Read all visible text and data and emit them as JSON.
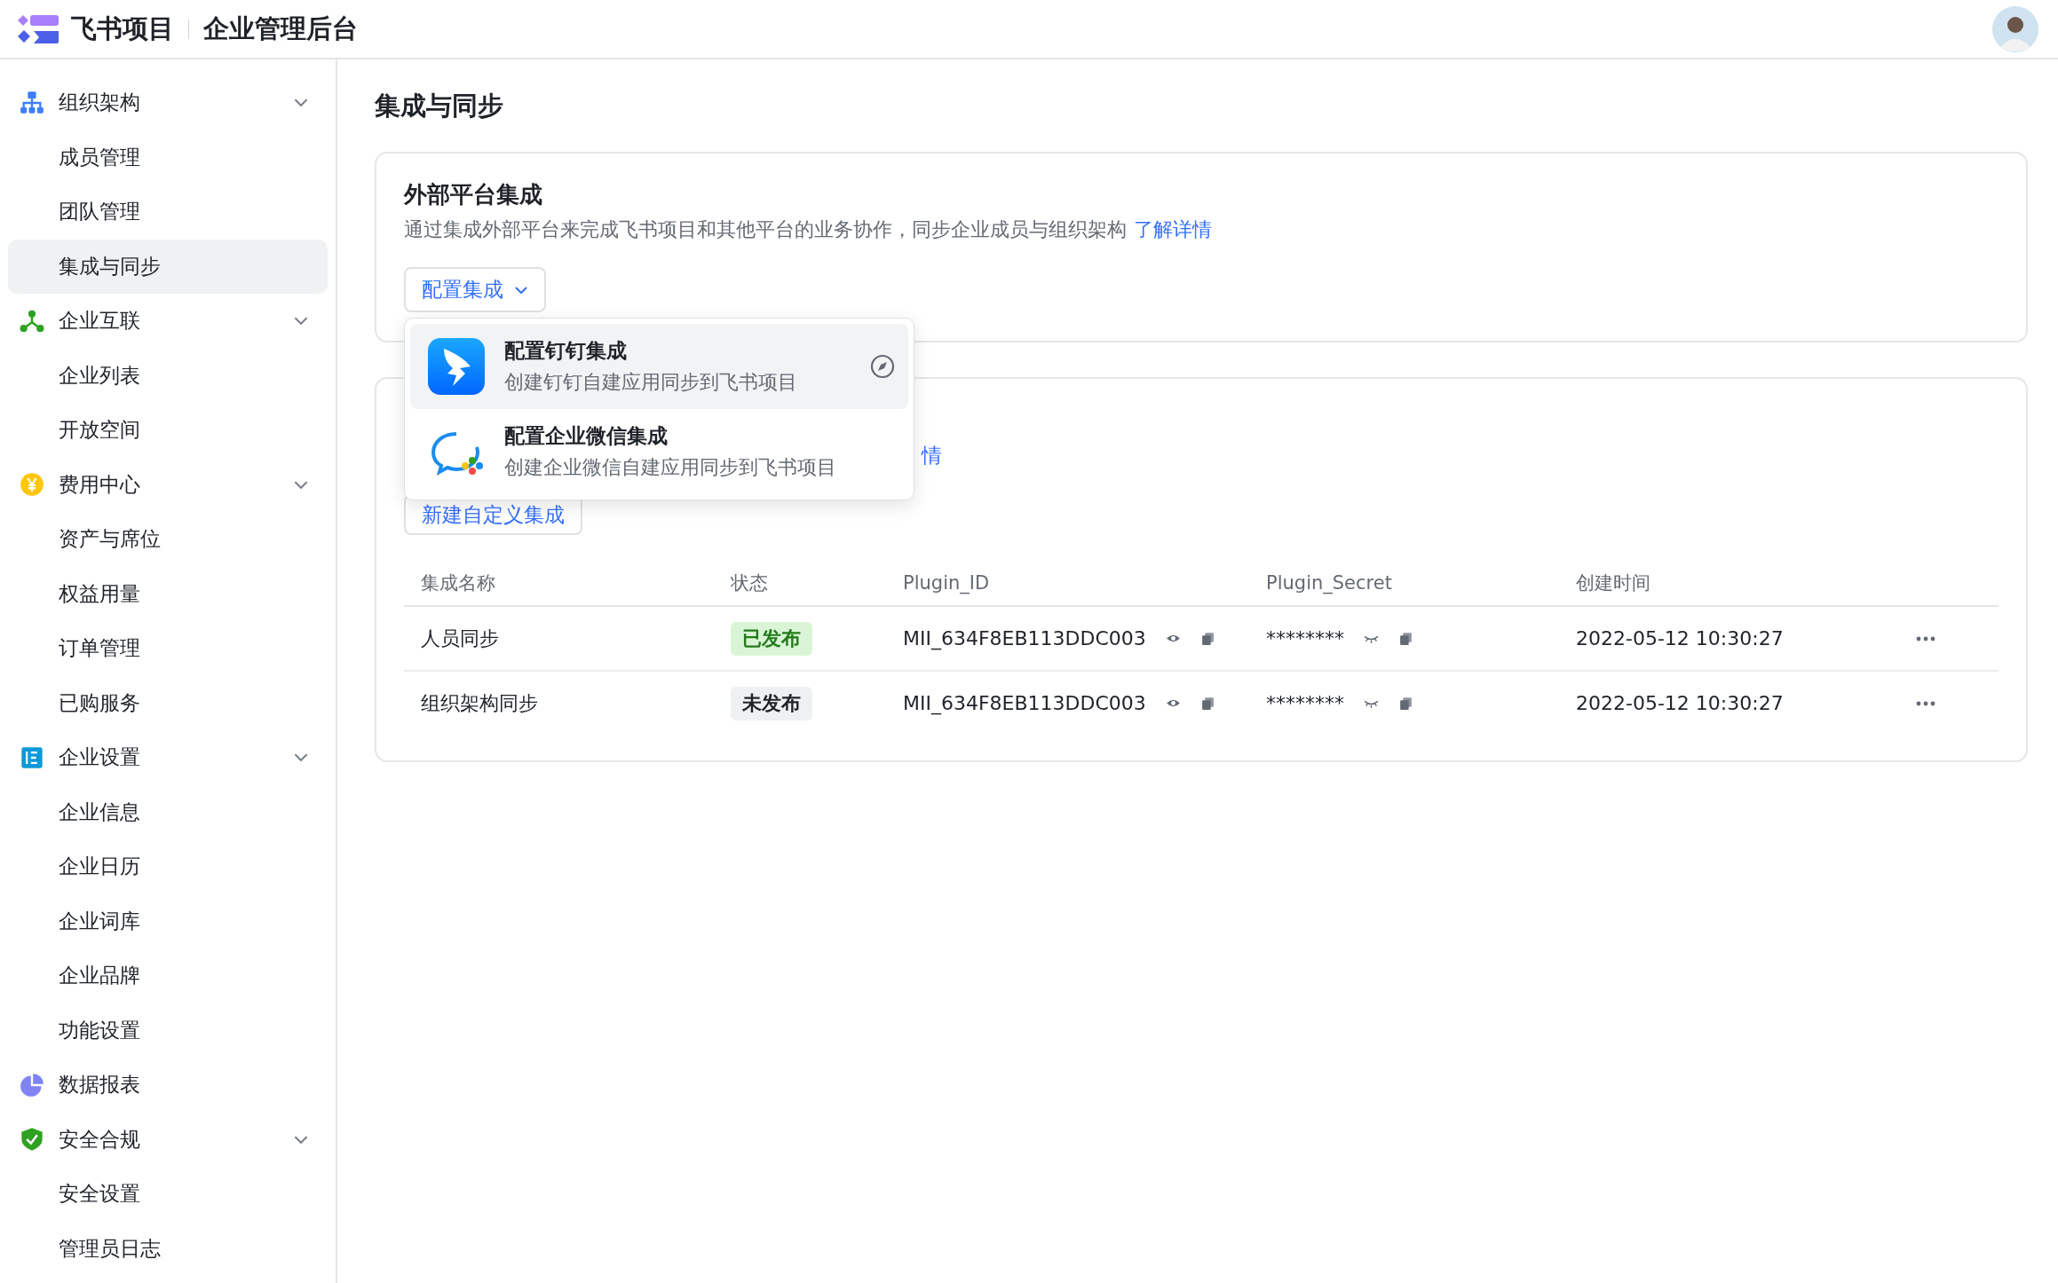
{
  "header": {
    "product": "飞书项目",
    "title": "企业管理后台"
  },
  "sidebar": {
    "groups": [
      {
        "label": "组织架构",
        "kind": "org",
        "expandable": true,
        "items": [
          {
            "label": "成员管理",
            "selected": false
          },
          {
            "label": "团队管理",
            "selected": false
          },
          {
            "label": "集成与同步",
            "selected": true
          }
        ]
      },
      {
        "label": "企业互联",
        "kind": "network",
        "expandable": true,
        "items": [
          {
            "label": "企业列表",
            "selected": false
          },
          {
            "label": "开放空间",
            "selected": false
          }
        ]
      },
      {
        "label": "费用中心",
        "kind": "money",
        "expandable": true,
        "items": [
          {
            "label": "资产与席位",
            "selected": false
          },
          {
            "label": "权益用量",
            "selected": false
          },
          {
            "label": "订单管理",
            "selected": false
          },
          {
            "label": "已购服务",
            "selected": false
          }
        ]
      },
      {
        "label": "企业设置",
        "kind": "settings",
        "expandable": true,
        "items": [
          {
            "label": "企业信息",
            "selected": false
          },
          {
            "label": "企业日历",
            "selected": false
          },
          {
            "label": "企业词库",
            "selected": false
          },
          {
            "label": "企业品牌",
            "selected": false
          },
          {
            "label": "功能设置",
            "selected": false
          }
        ]
      },
      {
        "label": "数据报表",
        "kind": "report",
        "expandable": false
      },
      {
        "label": "安全合规",
        "kind": "security",
        "expandable": true,
        "items": [
          {
            "label": "安全设置",
            "selected": false
          },
          {
            "label": "管理员日志",
            "selected": false
          }
        ]
      }
    ]
  },
  "page_title": "集成与同步",
  "external_card": {
    "title": "外部平台集成",
    "description": "通过集成外部平台来完成飞书项目和其他平台的业务协作，同步企业成员与组织架构",
    "link": "了解详情",
    "button": "配置集成"
  },
  "dropdown": {
    "items": [
      {
        "kind": "dingtalk",
        "title": "配置钉钉集成",
        "subtitle": "创建钉钉自建应用同步到飞书项目",
        "selected": true
      },
      {
        "kind": "wecom",
        "title": "配置企业微信集成",
        "subtitle": "创建企业微信自建应用同步到飞书项目",
        "selected": false
      }
    ]
  },
  "custom_card": {
    "link": "情",
    "button": "新建自定义集成",
    "table": {
      "columns": [
        "集成名称",
        "状态",
        "Plugin_ID",
        "Plugin_Secret",
        "创建时间"
      ],
      "rows": [
        {
          "name": "人员同步",
          "status": "已发布",
          "published": true,
          "plugin_id": "MII_634F8EB113DDC003",
          "plugin_secret": "********",
          "created": "2022-05-12 10:30:27"
        },
        {
          "name": "组织架构同步",
          "status": "未发布",
          "published": false,
          "plugin_id": "MII_634F8EB113DDC003",
          "plugin_secret": "********",
          "created": "2022-05-12 10:30:27"
        }
      ]
    }
  }
}
